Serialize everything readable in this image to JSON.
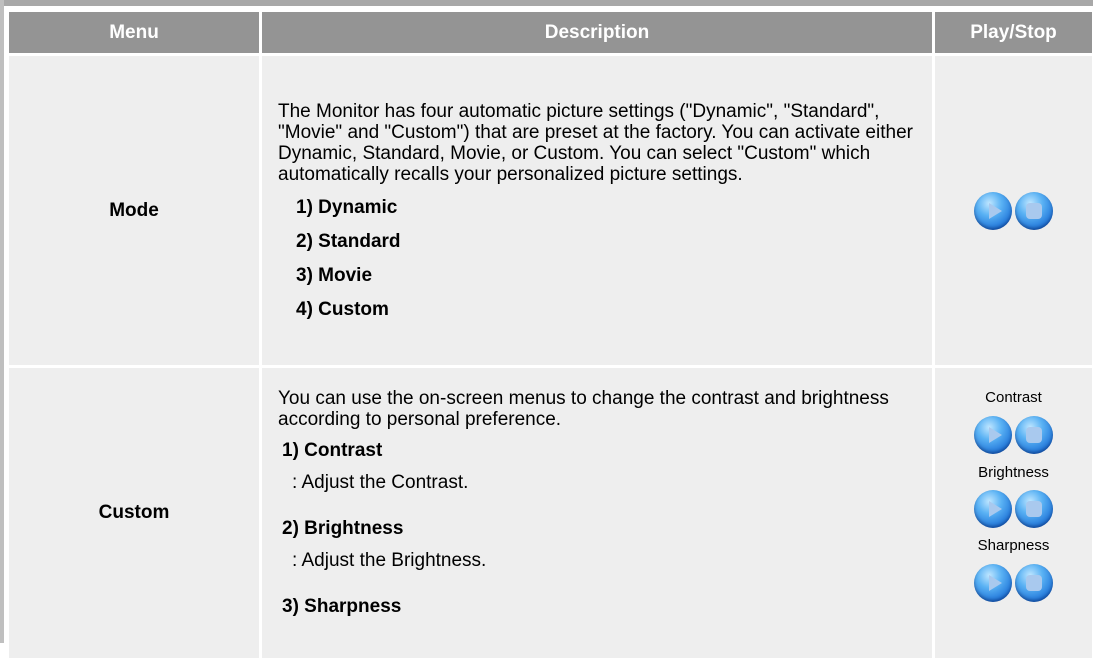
{
  "table": {
    "headers": {
      "menu": "Menu",
      "description": "Description",
      "play_stop": "Play/Stop"
    },
    "rows": [
      {
        "menu": "Mode",
        "description": "The Monitor has four automatic picture settings (\"Dynamic\", \"Standard\", \"Movie\" and \"Custom\") that are preset at the factory. You can activate either Dynamic, Standard, Movie, or Custom. You can select \"Custom\" which automatically recalls your personalized picture settings.",
        "items": [
          "1) Dynamic",
          "2) Standard",
          "3) Movie",
          "4) Custom"
        ]
      },
      {
        "menu": "Custom",
        "description": "You can use the on-screen menus to change the contrast and brightness according to personal preference.",
        "items": [
          {
            "title": "1) Contrast",
            "note": ": Adjust the Contrast."
          },
          {
            "title": "2) Brightness",
            "note": ": Adjust the Brightness."
          },
          {
            "title": "3) Sharpness",
            "note": ""
          }
        ],
        "play_labels": [
          "Contrast",
          "Brightness",
          "Sharpness"
        ]
      }
    ]
  },
  "icons": {
    "play": "play-icon",
    "stop": "stop-icon",
    "accent": "#1f74d8"
  }
}
